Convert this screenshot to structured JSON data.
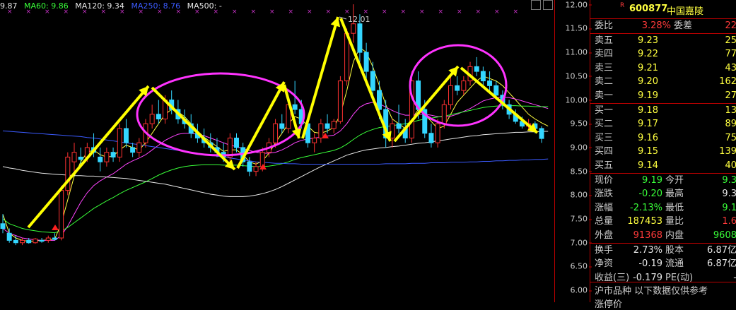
{
  "ma_legend": [
    {
      "label": "9.87",
      "color": "#e8e8e8"
    },
    {
      "label": "MA60: 9.86",
      "color": "#39ff39"
    },
    {
      "label": "MA120: 9.34",
      "color": "#e8e8e8"
    },
    {
      "label": "MA250: 8.76",
      "color": "#3b5bff"
    },
    {
      "label": "MA500: -",
      "color": "#e8e8e8"
    }
  ],
  "peak_label": "12.01",
  "yticks": [
    "12.00",
    "11.50",
    "11.00",
    "10.50",
    "10.00",
    "9.50",
    "9.00",
    "8.50",
    "8.00",
    "7.50",
    "7.00",
    "6.50",
    "6.00"
  ],
  "colors": {
    "up": "#ff3232",
    "down": "#34d6ff",
    "ma_yellow": "#ffff40",
    "ma_green": "#39ff39",
    "ma_blue": "#3b5bff",
    "ma_magenta": "#ff44ff",
    "arrow": "#ffff00",
    "ellipse": "#ff33ff"
  },
  "chart_data": {
    "type": "candlestick",
    "ylim": [
      5.75,
      12.1
    ],
    "candles": [
      {
        "o": 7.4,
        "h": 7.6,
        "l": 7.2,
        "c": 7.3
      },
      {
        "o": 7.2,
        "h": 7.3,
        "l": 7.0,
        "c": 7.05
      },
      {
        "o": 7.05,
        "h": 7.15,
        "l": 6.95,
        "c": 7.0
      },
      {
        "o": 7.0,
        "h": 7.1,
        "l": 6.95,
        "c": 7.05
      },
      {
        "o": 7.05,
        "h": 7.1,
        "l": 6.98,
        "c": 7.0
      },
      {
        "o": 7.0,
        "h": 7.1,
        "l": 6.98,
        "c": 7.08
      },
      {
        "o": 7.05,
        "h": 7.1,
        "l": 7.0,
        "c": 7.03
      },
      {
        "o": 7.05,
        "h": 7.15,
        "l": 7.0,
        "c": 7.1
      },
      {
        "o": 7.1,
        "h": 7.2,
        "l": 7.05,
        "c": 7.07
      },
      {
        "o": 7.1,
        "h": 8.2,
        "l": 7.05,
        "c": 8.1
      },
      {
        "o": 8.1,
        "h": 8.9,
        "l": 8.0,
        "c": 8.8
      },
      {
        "o": 8.7,
        "h": 9.1,
        "l": 8.5,
        "c": 8.9
      },
      {
        "o": 8.8,
        "h": 9.0,
        "l": 8.6,
        "c": 8.75
      },
      {
        "o": 8.8,
        "h": 9.1,
        "l": 8.7,
        "c": 9.0
      },
      {
        "o": 9.0,
        "h": 9.3,
        "l": 8.8,
        "c": 8.9
      },
      {
        "o": 8.8,
        "h": 9.0,
        "l": 8.5,
        "c": 8.7
      },
      {
        "o": 8.7,
        "h": 9.0,
        "l": 8.6,
        "c": 8.9
      },
      {
        "o": 8.9,
        "h": 9.0,
        "l": 8.7,
        "c": 8.8
      },
      {
        "o": 8.8,
        "h": 9.5,
        "l": 8.7,
        "c": 9.4
      },
      {
        "o": 9.4,
        "h": 9.6,
        "l": 9.0,
        "c": 9.1
      },
      {
        "o": 9.0,
        "h": 9.1,
        "l": 8.8,
        "c": 8.9
      },
      {
        "o": 8.9,
        "h": 9.2,
        "l": 8.8,
        "c": 9.1
      },
      {
        "o": 9.1,
        "h": 9.6,
        "l": 9.0,
        "c": 9.5
      },
      {
        "o": 9.5,
        "h": 9.9,
        "l": 9.4,
        "c": 9.7
      },
      {
        "o": 9.7,
        "h": 10.0,
        "l": 9.5,
        "c": 9.6
      },
      {
        "o": 9.6,
        "h": 10.1,
        "l": 9.5,
        "c": 10.0
      },
      {
        "o": 10.0,
        "h": 10.2,
        "l": 9.7,
        "c": 9.8
      },
      {
        "o": 9.8,
        "h": 10.0,
        "l": 9.5,
        "c": 9.6
      },
      {
        "o": 9.6,
        "h": 9.8,
        "l": 9.4,
        "c": 9.5
      },
      {
        "o": 9.5,
        "h": 9.7,
        "l": 9.2,
        "c": 9.3
      },
      {
        "o": 9.3,
        "h": 9.5,
        "l": 9.1,
        "c": 9.2
      },
      {
        "o": 9.2,
        "h": 9.4,
        "l": 9.0,
        "c": 9.1
      },
      {
        "o": 9.1,
        "h": 9.3,
        "l": 8.9,
        "c": 9.0
      },
      {
        "o": 9.0,
        "h": 9.2,
        "l": 8.8,
        "c": 8.9
      },
      {
        "o": 8.9,
        "h": 9.1,
        "l": 8.7,
        "c": 8.8
      },
      {
        "o": 8.8,
        "h": 9.3,
        "l": 8.7,
        "c": 9.2
      },
      {
        "o": 9.2,
        "h": 9.3,
        "l": 8.9,
        "c": 9.0
      },
      {
        "o": 9.0,
        "h": 9.1,
        "l": 8.6,
        "c": 8.7
      },
      {
        "o": 8.7,
        "h": 8.8,
        "l": 8.4,
        "c": 8.5
      },
      {
        "o": 8.5,
        "h": 8.7,
        "l": 8.4,
        "c": 8.6
      },
      {
        "o": 8.6,
        "h": 9.0,
        "l": 8.5,
        "c": 8.9
      },
      {
        "o": 8.9,
        "h": 9.2,
        "l": 8.8,
        "c": 9.1
      },
      {
        "o": 9.1,
        "h": 9.6,
        "l": 9.0,
        "c": 9.5
      },
      {
        "o": 9.5,
        "h": 9.7,
        "l": 9.3,
        "c": 9.4
      },
      {
        "o": 9.4,
        "h": 10.0,
        "l": 9.3,
        "c": 9.9
      },
      {
        "o": 9.9,
        "h": 10.4,
        "l": 9.7,
        "c": 9.8
      },
      {
        "o": 9.8,
        "h": 10.0,
        "l": 9.4,
        "c": 9.5
      },
      {
        "o": 9.5,
        "h": 9.6,
        "l": 9.0,
        "c": 9.1
      },
      {
        "o": 9.1,
        "h": 9.3,
        "l": 8.9,
        "c": 9.2
      },
      {
        "o": 9.2,
        "h": 9.6,
        "l": 9.1,
        "c": 9.5
      },
      {
        "o": 9.5,
        "h": 9.7,
        "l": 9.3,
        "c": 9.4
      },
      {
        "o": 9.4,
        "h": 9.6,
        "l": 9.3,
        "c": 9.55
      },
      {
        "o": 9.55,
        "h": 10.5,
        "l": 9.5,
        "c": 10.4
      },
      {
        "o": 10.4,
        "h": 11.5,
        "l": 10.3,
        "c": 11.4
      },
      {
        "o": 11.4,
        "h": 12.01,
        "l": 11.2,
        "c": 11.6
      },
      {
        "o": 11.6,
        "h": 11.8,
        "l": 10.8,
        "c": 11.0
      },
      {
        "o": 11.0,
        "h": 11.2,
        "l": 10.4,
        "c": 10.6
      },
      {
        "o": 10.6,
        "h": 10.8,
        "l": 10.0,
        "c": 10.2
      },
      {
        "o": 10.2,
        "h": 10.4,
        "l": 9.6,
        "c": 9.8
      },
      {
        "o": 9.8,
        "h": 10.0,
        "l": 9.0,
        "c": 9.2
      },
      {
        "o": 9.2,
        "h": 9.6,
        "l": 9.0,
        "c": 9.5
      },
      {
        "o": 9.5,
        "h": 9.9,
        "l": 9.3,
        "c": 9.4
      },
      {
        "o": 9.4,
        "h": 9.6,
        "l": 9.1,
        "c": 9.2
      },
      {
        "o": 9.2,
        "h": 10.6,
        "l": 9.1,
        "c": 10.4
      },
      {
        "o": 10.4,
        "h": 10.6,
        "l": 9.6,
        "c": 9.8
      },
      {
        "o": 9.8,
        "h": 10.0,
        "l": 9.2,
        "c": 9.3
      },
      {
        "o": 9.3,
        "h": 9.5,
        "l": 9.0,
        "c": 9.1
      },
      {
        "o": 9.1,
        "h": 9.6,
        "l": 9.0,
        "c": 9.5
      },
      {
        "o": 9.5,
        "h": 10.0,
        "l": 9.4,
        "c": 9.9
      },
      {
        "o": 9.9,
        "h": 10.5,
        "l": 9.8,
        "c": 10.3
      },
      {
        "o": 10.3,
        "h": 10.5,
        "l": 10.1,
        "c": 10.2
      },
      {
        "o": 10.2,
        "h": 10.5,
        "l": 10.1,
        "c": 10.4
      },
      {
        "o": 10.4,
        "h": 10.8,
        "l": 10.3,
        "c": 10.7
      },
      {
        "o": 10.7,
        "h": 10.9,
        "l": 10.5,
        "c": 10.6
      },
      {
        "o": 10.6,
        "h": 10.7,
        "l": 10.3,
        "c": 10.4
      },
      {
        "o": 10.4,
        "h": 10.6,
        "l": 10.2,
        "c": 10.3
      },
      {
        "o": 10.3,
        "h": 10.4,
        "l": 10.0,
        "c": 10.1
      },
      {
        "o": 10.1,
        "h": 10.2,
        "l": 9.8,
        "c": 9.9
      },
      {
        "o": 9.9,
        "h": 10.0,
        "l": 9.6,
        "c": 9.7
      },
      {
        "o": 9.7,
        "h": 9.8,
        "l": 9.5,
        "c": 9.55
      },
      {
        "o": 9.55,
        "h": 9.65,
        "l": 9.4,
        "c": 9.45
      },
      {
        "o": 9.45,
        "h": 9.6,
        "l": 9.35,
        "c": 9.5
      },
      {
        "o": 9.5,
        "h": 9.55,
        "l": 9.3,
        "c": 9.4
      },
      {
        "o": 9.4,
        "h": 9.45,
        "l": 9.1,
        "c": 9.19
      }
    ],
    "ma_lines": [
      {
        "name": "ma_short",
        "color": "#ffff40",
        "values": [
          7.6,
          7.2,
          7.1,
          7.05,
          7.03,
          7.04,
          7.05,
          7.06,
          7.08,
          7.4,
          7.9,
          8.4,
          8.7,
          8.9,
          8.95,
          8.85,
          8.8,
          8.82,
          8.95,
          9.05,
          9.0,
          8.95,
          9.1,
          9.3,
          9.5,
          9.7,
          9.8,
          9.75,
          9.65,
          9.5,
          9.35,
          9.22,
          9.12,
          9.02,
          8.92,
          8.95,
          8.95,
          8.85,
          8.7,
          8.65,
          8.72,
          8.88,
          9.1,
          9.3,
          9.5,
          9.65,
          9.6,
          9.45,
          9.32,
          9.3,
          9.35,
          9.42,
          9.7,
          10.2,
          10.8,
          11.1,
          11.0,
          10.7,
          10.3,
          9.9,
          9.6,
          9.5,
          9.4,
          9.6,
          9.8,
          9.7,
          9.55,
          9.4,
          9.45,
          9.7,
          9.95,
          10.1,
          10.25,
          10.4,
          10.5,
          10.45,
          10.4,
          10.3,
          10.15,
          10.0,
          9.85,
          9.7,
          9.6,
          9.52,
          9.45
        ]
      },
      {
        "name": "ma_mid",
        "color": "#ff44ff",
        "values": [
          7.3,
          7.2,
          7.15,
          7.1,
          7.08,
          7.06,
          7.05,
          7.05,
          7.05,
          7.15,
          7.35,
          7.6,
          7.85,
          8.05,
          8.2,
          8.3,
          8.38,
          8.45,
          8.55,
          8.65,
          8.72,
          8.78,
          8.85,
          8.95,
          9.05,
          9.15,
          9.22,
          9.28,
          9.3,
          9.3,
          9.28,
          9.25,
          9.2,
          9.15,
          9.1,
          9.05,
          9.02,
          8.98,
          8.94,
          8.9,
          8.88,
          8.88,
          8.9,
          8.95,
          9.02,
          9.1,
          9.15,
          9.18,
          9.2,
          9.22,
          9.24,
          9.26,
          9.35,
          9.5,
          9.7,
          9.85,
          9.92,
          9.95,
          9.92,
          9.85,
          9.78,
          9.72,
          9.68,
          9.68,
          9.7,
          9.7,
          9.68,
          9.65,
          9.64,
          9.66,
          9.7,
          9.76,
          9.82,
          9.9,
          9.98,
          10.02,
          10.05,
          10.06,
          10.05,
          10.02,
          9.98,
          9.94,
          9.9,
          9.86,
          9.82
        ]
      },
      {
        "name": "ma60",
        "color": "#39ff39",
        "values": [
          7.5,
          7.4,
          7.35,
          7.3,
          7.27,
          7.25,
          7.23,
          7.22,
          7.21,
          7.25,
          7.32,
          7.42,
          7.52,
          7.62,
          7.72,
          7.8,
          7.88,
          7.95,
          8.03,
          8.1,
          8.16,
          8.22,
          8.28,
          8.35,
          8.42,
          8.48,
          8.53,
          8.57,
          8.6,
          8.62,
          8.63,
          8.64,
          8.64,
          8.64,
          8.63,
          8.63,
          8.63,
          8.62,
          8.61,
          8.6,
          8.6,
          8.61,
          8.63,
          8.66,
          8.7,
          8.75,
          8.79,
          8.82,
          8.85,
          8.88,
          8.91,
          8.94,
          8.99,
          9.07,
          9.17,
          9.26,
          9.33,
          9.38,
          9.42,
          9.44,
          9.46,
          9.48,
          9.5,
          9.53,
          9.57,
          9.6,
          9.62,
          9.64,
          9.66,
          9.69,
          9.72,
          9.75,
          9.78,
          9.81,
          9.84,
          9.86,
          9.87,
          9.88,
          9.88,
          9.88,
          9.87,
          9.87,
          9.86,
          9.86,
          9.86
        ]
      },
      {
        "name": "ma120",
        "color": "#e8e8e8",
        "values": [
          8.6,
          8.57,
          8.55,
          8.52,
          8.5,
          8.48,
          8.46,
          8.45,
          8.44,
          8.43,
          8.42,
          8.41,
          8.41,
          8.4,
          8.4,
          8.39,
          8.38,
          8.37,
          8.36,
          8.35,
          8.33,
          8.31,
          8.29,
          8.27,
          8.25,
          8.23,
          8.2,
          8.17,
          8.14,
          8.11,
          8.08,
          8.05,
          8.02,
          8.0,
          7.98,
          7.97,
          7.97,
          7.97,
          7.98,
          8.0,
          8.03,
          8.07,
          8.12,
          8.18,
          8.25,
          8.32,
          8.39,
          8.46,
          8.53,
          8.6,
          8.66,
          8.72,
          8.78,
          8.84,
          8.88,
          8.92,
          8.95,
          8.97,
          8.99,
          9.0,
          9.02,
          9.03,
          9.05,
          9.07,
          9.09,
          9.1,
          9.12,
          9.14,
          9.16,
          9.18,
          9.2,
          9.22,
          9.24,
          9.25,
          9.27,
          9.28,
          9.29,
          9.3,
          9.31,
          9.32,
          9.32,
          9.33,
          9.33,
          9.34,
          9.34
        ]
      },
      {
        "name": "ma250",
        "color": "#3b5bff",
        "values": [
          9.35,
          9.34,
          9.33,
          9.32,
          9.31,
          9.3,
          9.29,
          9.28,
          9.27,
          9.26,
          9.25,
          9.24,
          9.23,
          9.21,
          9.2,
          9.18,
          9.16,
          9.14,
          9.12,
          9.1,
          9.08,
          9.06,
          9.04,
          9.02,
          9.0,
          8.98,
          8.96,
          8.94,
          8.92,
          8.9,
          8.88,
          8.86,
          8.84,
          8.82,
          8.8,
          8.78,
          8.76,
          8.74,
          8.72,
          8.7,
          8.69,
          8.68,
          8.67,
          8.67,
          8.66,
          8.66,
          8.65,
          8.65,
          8.65,
          8.65,
          8.65,
          8.65,
          8.65,
          8.65,
          8.65,
          8.65,
          8.65,
          8.65,
          8.65,
          8.66,
          8.66,
          8.66,
          8.66,
          8.67,
          8.67,
          8.67,
          8.68,
          8.68,
          8.68,
          8.69,
          8.69,
          8.69,
          8.7,
          8.7,
          8.71,
          8.71,
          8.72,
          8.72,
          8.73,
          8.73,
          8.74,
          8.74,
          8.75,
          8.75,
          8.76
        ]
      }
    ]
  },
  "panel": {
    "code": "600877",
    "name": "中国嘉陵",
    "r_badge": "R",
    "webi_label": "委比",
    "webi_value": "3.28%",
    "weicha_label": "委差",
    "weicha_value": "22",
    "sells": [
      {
        "label": "卖五",
        "price": "9.23",
        "qty": "25"
      },
      {
        "label": "卖四",
        "price": "9.22",
        "qty": "77"
      },
      {
        "label": "卖三",
        "price": "9.21",
        "qty": "43"
      },
      {
        "label": "卖二",
        "price": "9.20",
        "qty": "162"
      },
      {
        "label": "卖一",
        "price": "9.19",
        "qty": "27"
      }
    ],
    "buys": [
      {
        "label": "买一",
        "price": "9.18",
        "qty": "13"
      },
      {
        "label": "买二",
        "price": "9.17",
        "qty": "89"
      },
      {
        "label": "买三",
        "price": "9.16",
        "qty": "75"
      },
      {
        "label": "买四",
        "price": "9.15",
        "qty": "139"
      },
      {
        "label": "买五",
        "price": "9.14",
        "qty": "40"
      }
    ],
    "stats": [
      {
        "l1": "现价",
        "v1": "9.19",
        "c1": "green",
        "l2": "今开",
        "v2": "9.3",
        "c2": "green"
      },
      {
        "l1": "涨跌",
        "v1": "-0.20",
        "c1": "green",
        "l2": "最高",
        "v2": "9.3",
        "c2": "white"
      },
      {
        "l1": "涨幅",
        "v1": "-2.13%",
        "c1": "green",
        "l2": "最低",
        "v2": "9.1",
        "c2": "green"
      },
      {
        "l1": "总量",
        "v1": "187453",
        "c1": "yel",
        "l2": "量比",
        "v2": "1.6",
        "c2": "red"
      },
      {
        "l1": "外盘",
        "v1": "91368",
        "c1": "red",
        "l2": "内盘",
        "v2": "9608",
        "c2": "green"
      }
    ],
    "stats2": [
      {
        "l1": "换手",
        "v1": "2.73%",
        "l2": "股本",
        "v2": "6.87亿"
      },
      {
        "l1": "净资",
        "v1": "-0.19",
        "l2": "流通",
        "v2": "6.87亿"
      },
      {
        "l1": "收益(三)",
        "v1": "-0.179",
        "l2": "PE(动)",
        "v2": "-"
      }
    ],
    "footer1": "沪市品种  以下数据仅供参考",
    "footer2": "涨停价"
  }
}
